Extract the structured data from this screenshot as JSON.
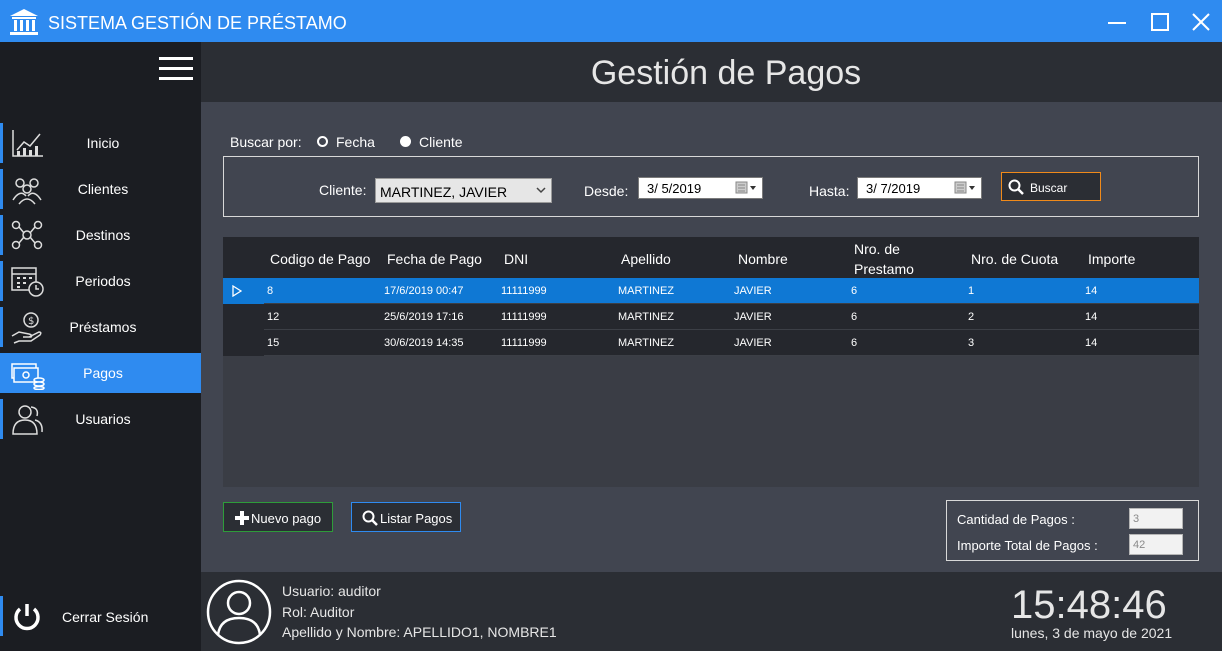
{
  "window": {
    "title": "SISTEMA GESTIÓN DE PRÉSTAMO"
  },
  "sidebar": {
    "items": [
      {
        "label": "Inicio",
        "icon": "chart-icon"
      },
      {
        "label": "Clientes",
        "icon": "clients-icon"
      },
      {
        "label": "Destinos",
        "icon": "network-icon"
      },
      {
        "label": "Periodos",
        "icon": "calendar-icon"
      },
      {
        "label": "Préstamos",
        "icon": "money-hand-icon"
      },
      {
        "label": "Pagos",
        "icon": "payments-icon",
        "active": true
      },
      {
        "label": "Usuarios",
        "icon": "users-icon"
      }
    ],
    "logout_label": "Cerrar Sesión"
  },
  "page": {
    "title": "Gestión de Pagos"
  },
  "search": {
    "by_label": "Buscar por:",
    "option_fecha": "Fecha",
    "option_cliente": "Cliente",
    "selected": "Fecha",
    "cliente_label": "Cliente:",
    "cliente_value": "MARTINEZ, JAVIER",
    "desde_label": "Desde:",
    "desde_value": "3/ 5/2019",
    "hasta_label": "Hasta:",
    "hasta_value": "3/ 7/2019",
    "button_label": "Buscar"
  },
  "table": {
    "headers": [
      "Codigo de Pago",
      "Fecha de Pago",
      "DNI",
      "Apellido",
      "Nombre",
      "Nro. de",
      "Prestamo",
      "Nro. de Cuota",
      "Importe"
    ],
    "rows": [
      [
        "8",
        "17/6/2019 00:47",
        "11111999",
        "MARTINEZ",
        "JAVIER",
        "6",
        "1",
        "14"
      ],
      [
        "12",
        "25/6/2019 17:16",
        "11111999",
        "MARTINEZ",
        "JAVIER",
        "6",
        "2",
        "14"
      ],
      [
        "15",
        "30/6/2019 14:35",
        "11111999",
        "MARTINEZ",
        "JAVIER",
        "6",
        "3",
        "14"
      ]
    ]
  },
  "actions": {
    "new_label": "Nuevo pago",
    "list_label": "Listar Pagos"
  },
  "summary": {
    "count_label": "Cantidad de Pagos :",
    "count_value": "3",
    "total_label": "Importe Total de Pagos :",
    "total_value": "42"
  },
  "user": {
    "usuario": "Usuario: auditor",
    "rol": "Rol: Auditor",
    "nombre": "Apellido y Nombre: APELLIDO1, NOMBRE1"
  },
  "clock": {
    "time": "15:48:46",
    "date": "lunes, 3 de mayo de 2021"
  },
  "colors": {
    "accent": "#2f8bf0",
    "selection": "#0f78d4",
    "search_border": "#f08a1a",
    "new_border": "#2e9c3a"
  }
}
